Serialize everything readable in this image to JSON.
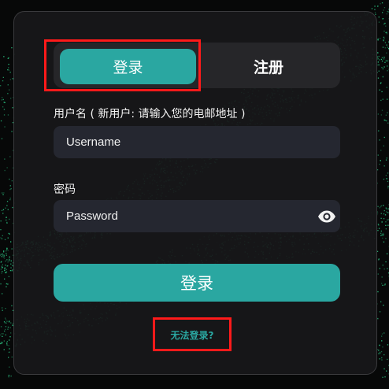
{
  "tabs": [
    {
      "label": "登录",
      "active": true
    },
    {
      "label": "注册",
      "active": false
    }
  ],
  "username": {
    "label": "用户名 ( 新用户: 请输入您的电邮地址 )",
    "placeholder": "Username",
    "value": ""
  },
  "password": {
    "label": "密码",
    "placeholder": "Password",
    "value": "",
    "toggle_icon": "eye-icon"
  },
  "submit_label": "登录",
  "forgot_label": "无法登录?",
  "colors": {
    "accent": "#2aa7a1",
    "card": "#18181a",
    "field": "#252730",
    "highlight": "#ff1a1a",
    "particles": "#2ecf8a"
  }
}
